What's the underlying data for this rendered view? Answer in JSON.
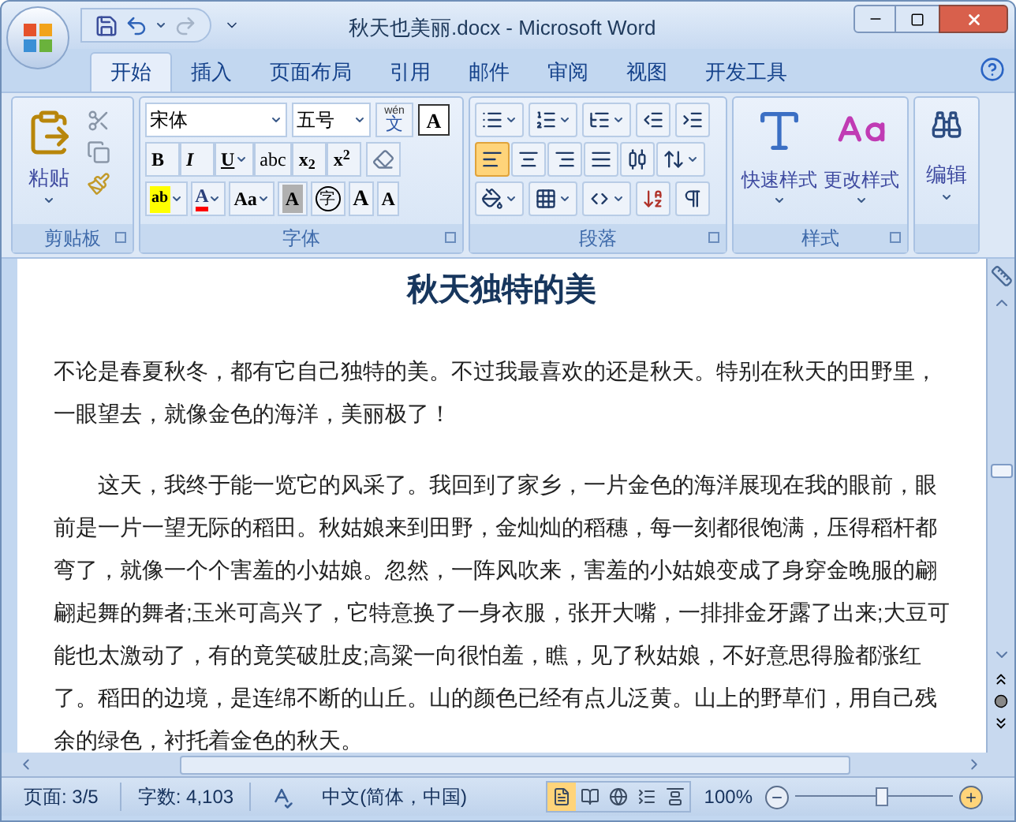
{
  "window": {
    "title": "秋天也美丽.docx - Microsoft Word"
  },
  "tabs": [
    {
      "label": "开始",
      "selected": true
    },
    {
      "label": "插入",
      "selected": false
    },
    {
      "label": "页面布局",
      "selected": false
    },
    {
      "label": "引用",
      "selected": false
    },
    {
      "label": "邮件",
      "selected": false
    },
    {
      "label": "审阅",
      "selected": false
    },
    {
      "label": "视图",
      "selected": false
    },
    {
      "label": "开发工具",
      "selected": false
    }
  ],
  "ribbon": {
    "clipboard": {
      "label": "剪贴板",
      "paste": "粘贴"
    },
    "font": {
      "label": "字体",
      "font_name": "宋体",
      "font_size": "五号",
      "phonetic_ruby": "wén",
      "phonetic_char": "文",
      "border_char": "A",
      "row1": [
        {
          "kind": "bold",
          "label": "B"
        },
        {
          "kind": "italic",
          "label": "I"
        },
        {
          "kind": "underline",
          "label": "U"
        },
        {
          "kind": "strike",
          "label": "abc"
        },
        {
          "kind": "plain",
          "label": "x$_{2}$"
        },
        {
          "kind": "plain",
          "label": "x$^{2}$"
        }
      ],
      "row2": [
        {
          "kind": "highlight",
          "label": "ab"
        },
        {
          "kind": "color",
          "label": "A"
        },
        {
          "kind": "case",
          "label": "Aa"
        },
        {
          "kind": "shade",
          "label": "A"
        },
        {
          "kind": "circle",
          "label": "字"
        },
        {
          "kind": "grow",
          "label": "A"
        },
        {
          "kind": "shrink",
          "label": "A"
        }
      ]
    },
    "paragraph": {
      "label": "段落",
      "align": [
        {
          "selected": true
        },
        {
          "selected": false
        },
        {
          "selected": false
        },
        {
          "selected": false
        },
        {
          "selected": false
        }
      ]
    },
    "styles": {
      "label": "样式",
      "quick": "快速样式",
      "change": "更改样式"
    },
    "editing": {
      "label": "编辑"
    }
  },
  "document": {
    "heading": "秋天独特的美",
    "paragraphs": [
      {
        "indent": false,
        "text": "不论是春夏秋冬，都有它自己独特的美。不过我最喜欢的还是秋天。特别在秋天的田野里，一眼望去，就像金色的海洋，美丽极了！"
      },
      {
        "indent": true,
        "text": "这天，我终于能一览它的风采了。我回到了家乡，一片金色的海洋展现在我的眼前，眼前是一片一望无际的稻田。秋姑娘来到田野，金灿灿的稻穗，每一刻都很饱满，压得稻杆都弯了，就像一个个害羞的小姑娘。忽然，一阵风吹来，害羞的小姑娘变成了身穿金晚服的翩翩起舞的舞者;玉米可高兴了，它特意换了一身衣服，张开大嘴，一排排金牙露了出来;大豆可能也太激动了，有的竟笑破肚皮;高粱一向很怕羞，瞧，见了秋姑娘，不好意思得脸都涨红了。稻田的边境，是连绵不断的山丘。山的颜色已经有点儿泛黄。山上的野草们，用自己残余的绿色，衬托着金色的秋天。"
      }
    ]
  },
  "status_bar": {
    "page": "页面: 3/5",
    "words": "字数: 4,103",
    "language": "中文(简体，中国)",
    "views": [
      {
        "selected": true
      },
      {
        "selected": false
      },
      {
        "selected": false
      },
      {
        "selected": false
      },
      {
        "selected": false
      }
    ],
    "zoom": "100%",
    "zoom_slider": {
      "level": 0.55
    }
  }
}
